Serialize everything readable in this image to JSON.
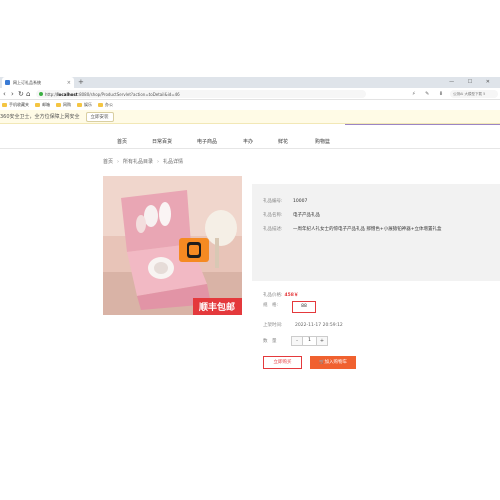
{
  "browser": {
    "tab_title": "网上订礼品系统",
    "tab_close": "×",
    "new_tab": "+",
    "window_controls": "— ☐ ✕",
    "nav": {
      "back": "‹",
      "forward": "›",
      "refresh": "↻",
      "home": "⌂"
    },
    "url_prefix": "http://",
    "url_host": "localhost",
    "url_rest": ":8080/shop/ProductServlet?action=toDetail&id=46",
    "tools": "⚡ ✎ ⬇ ⋯",
    "search_placeholder": "公测Ai 大模型下载 5"
  },
  "bookmarks": [
    {
      "label": "手机收藏夹"
    },
    {
      "label": "邮箱"
    },
    {
      "label": "网购"
    },
    {
      "label": "娱乐"
    },
    {
      "label": "办公"
    }
  ],
  "notice": {
    "text": "360安全卫士，全方位保障上网安全",
    "button": "立即安装"
  },
  "mainnav": {
    "items": [
      "首页",
      "日常百货",
      "电子商品",
      "丰办",
      "鲜花",
      "购物篮"
    ]
  },
  "breadcrumb": {
    "home": "首页",
    "category": "所有礼品目录",
    "current": "礼品详情",
    "sep": "›"
  },
  "product": {
    "image_badge": "顺丰包邮",
    "code_label": "礼品编号:",
    "code_value": "10007",
    "name_label": "礼品名称:",
    "name_value": "电子产品礼品",
    "desc_label": "礼品描述:",
    "desc_value": "一周年纪人礼女士的惊电子产品礼品 那憎色+小展猿铂神器+立体增置礼盒",
    "price_label": "礼品价格:",
    "price_value": "458￥",
    "spec_label": "规　格:",
    "spec_value": "88",
    "shelf_label": "上架时间:",
    "shelf_value": "2022-11-17 20:59:12",
    "qty_label": "数　量",
    "qty_minus": "-",
    "qty_value": "1",
    "qty_plus": "+",
    "buy_button": "立即购买",
    "cart_button": "加入购物车"
  },
  "colors": {
    "accent": "#e4393c",
    "cart_button": "#f0612f",
    "notice_bg": "#fffbe6",
    "panel_bg": "#f2f2f2"
  }
}
